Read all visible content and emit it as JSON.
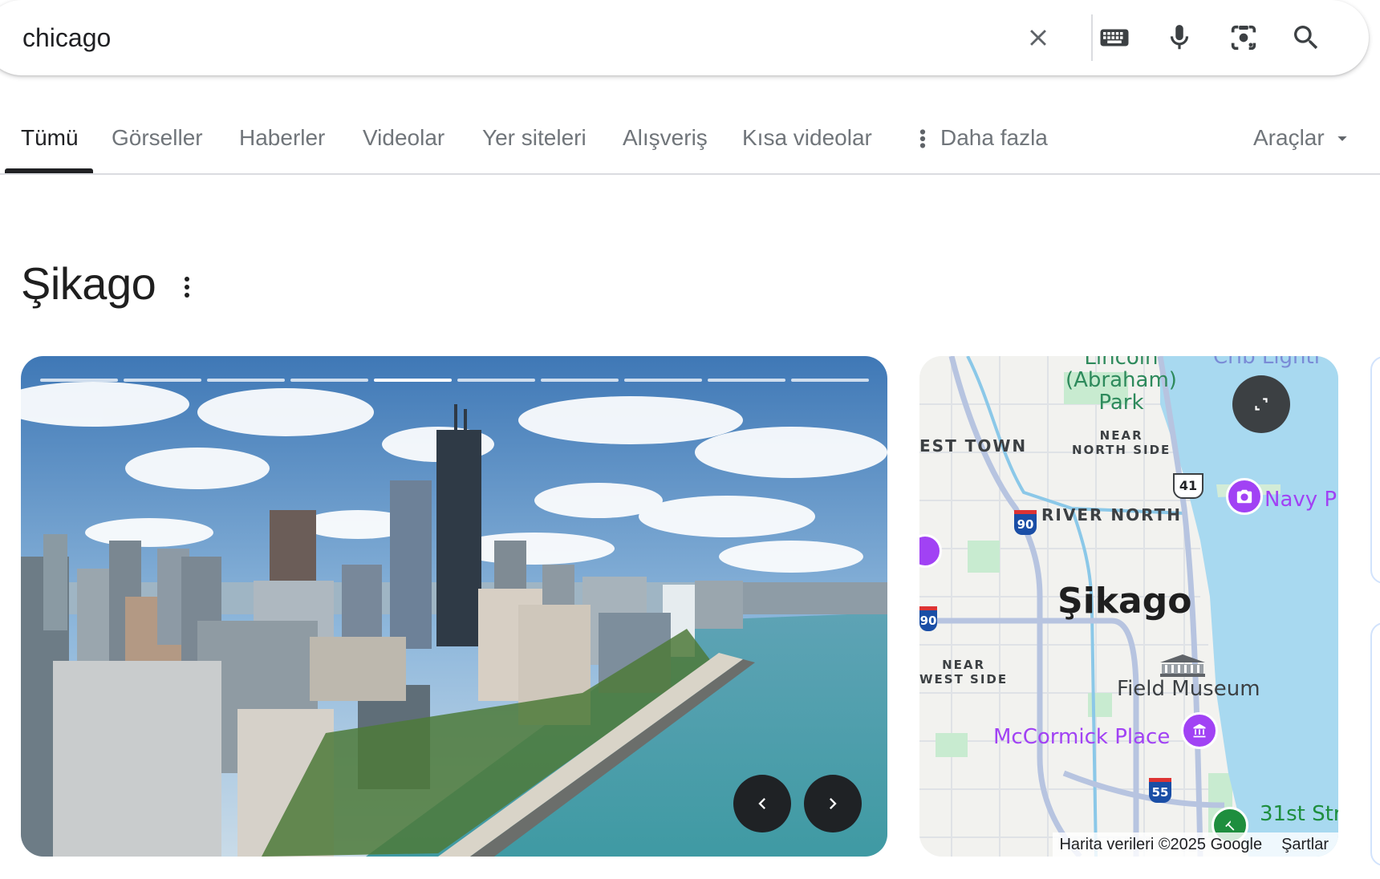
{
  "search": {
    "query": "chicago",
    "icons": [
      "close-icon",
      "keyboard-icon",
      "microphone-icon",
      "lens-camera-icon",
      "search-icon"
    ]
  },
  "tabs": [
    {
      "label": "Tümü",
      "active": true
    },
    {
      "label": "Görseller"
    },
    {
      "label": "Haberler"
    },
    {
      "label": "Videolar"
    },
    {
      "label": "Yer siteleri"
    },
    {
      "label": "Alışveriş"
    },
    {
      "label": "Kısa videolar"
    }
  ],
  "more_tab": {
    "label": "Daha fazla",
    "icon": "more-vert-icon"
  },
  "tools": {
    "label": "Araçlar",
    "icon": "caret-down-icon"
  },
  "entity": {
    "title": "Şikago"
  },
  "photo": {
    "slide_count": 10,
    "active_slide": 5,
    "prev_icon": "chevron-left-icon",
    "next_icon": "chevron-right-icon"
  },
  "map": {
    "labels": {
      "lincoln_park": "Lincoln\n(Abraham)\nPark",
      "crib": "Crib Lighti",
      "west_town": "EST TOWN",
      "near_north": "NEAR\nNORTH SIDE",
      "river_north": "RIVER NORTH",
      "navy_pier": "Navy P",
      "city": "Şikago",
      "near_west": "NEAR\nWEST SIDE",
      "field_museum": "Field Museum",
      "mccormick": "McCormick Place",
      "st31": "31st Str",
      "hwy41": "41",
      "i90a": "90",
      "i90b": "90",
      "i55": "55"
    },
    "attribution": "Harita verileri ©2025 Google",
    "terms": "Şartlar",
    "colors": {
      "water": "#a8d9f0",
      "road": "#b7c4e0",
      "park": "#c8ebd0",
      "poi": "#a142f4"
    }
  }
}
